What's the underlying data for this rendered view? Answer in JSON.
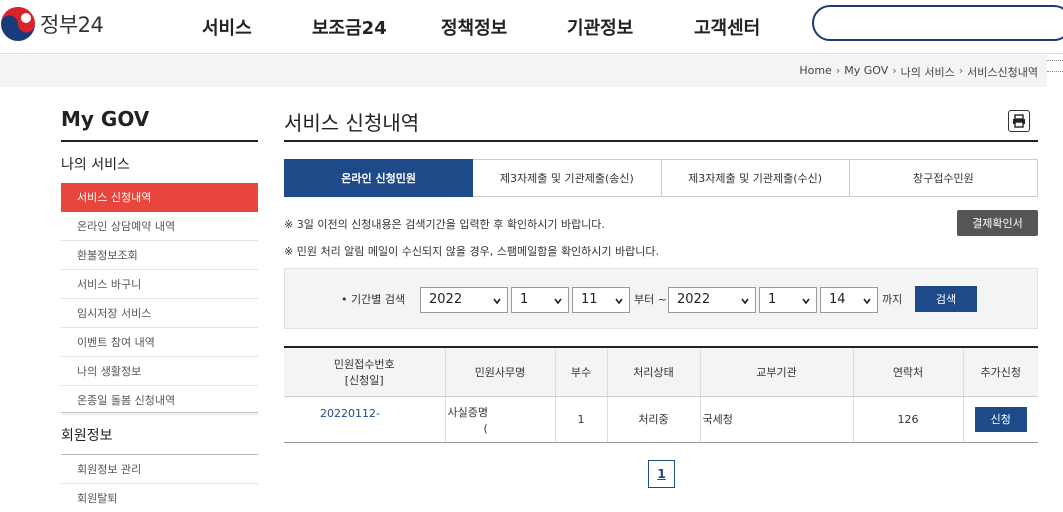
{
  "header": {
    "logo_text": "정부24",
    "nav": [
      "서비스",
      "보조금24",
      "정책정보",
      "기관정보",
      "고객센터"
    ]
  },
  "breadcrumb": [
    "Home",
    "My GOV",
    "나의 서비스",
    "서비스신청내역"
  ],
  "sidebar": {
    "title": "My GOV",
    "group1": "나의 서비스",
    "items": [
      "서비스 신청내역",
      "온라인 상담예약 내역",
      "환불정보조회",
      "서비스 바구니",
      "임시저장 서비스",
      "이벤트 참여 내역",
      "나의 생활정보",
      "온종일 돌봄 신청내역"
    ],
    "group2": "회원정보",
    "items2": [
      "회원정보 관리",
      "회원탈퇴"
    ]
  },
  "main": {
    "title": "서비스 신청내역",
    "tabs": [
      "온라인 신청민원",
      "제3자제출 및 기관제출(송신)",
      "제3자제출 및 기관제출(수신)",
      "창구접수민원"
    ],
    "notice1": "※ 3일 이전의 신청내용은 검색기간을 입력한 후 확인하시기 바랍니다.",
    "notice2": "※ 민원 처리 알림 메일이 수신되지 않을 경우, 스팸메일함을 확인하시기 바랍니다.",
    "pay_button": "결제확인서",
    "search": {
      "label": "• 기간별 검색",
      "from_year": "2022",
      "from_month": "1",
      "from_day": "11",
      "from_text": "부터 ~",
      "to_year": "2022",
      "to_month": "1",
      "to_day": "14",
      "to_text": "까지",
      "button": "검색"
    },
    "table": {
      "headers": [
        "민원접수번호",
        "[신청일]",
        "민원사무명",
        "부수",
        "처리상태",
        "교부기관",
        "연락처",
        "추가신청"
      ],
      "row": {
        "number": "20220112-",
        "name_line1": "사실증명",
        "name_line2": "(",
        "copies": "1",
        "status": "처리중",
        "agency": "국세청",
        "contact": "126",
        "action": "신청"
      }
    },
    "page": "1"
  },
  "colors": {
    "primary": "#1f4a8a",
    "active_side": "#e8463c"
  }
}
